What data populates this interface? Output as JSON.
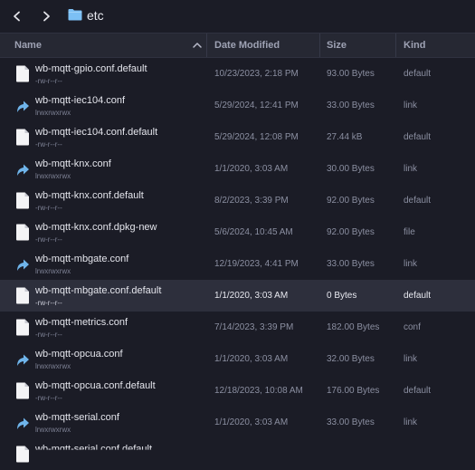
{
  "toolbar": {
    "back_icon": "chevron-left-icon",
    "forward_icon": "chevron-right-icon",
    "folder_icon": "folder-icon",
    "path": "etc"
  },
  "columns": {
    "name": "Name",
    "date": "Date Modified",
    "size": "Size",
    "kind": "Kind"
  },
  "colors": {
    "background": "#1b1c26",
    "header": "#262833",
    "selected_row": "#2d2f3c",
    "link_icon": "#6fb4ea",
    "file_icon": "#f4f4f6"
  },
  "files": [
    {
      "name": "wb-mqtt-gpio.conf.default",
      "perm": "-rw-r--r--",
      "date": "10/23/2023, 2:18 PM",
      "size": "93.00 Bytes",
      "kind": "default",
      "icon": "file-icon"
    },
    {
      "name": "wb-mqtt-iec104.conf",
      "perm": "lrwxrwxrwx",
      "date": "5/29/2024, 12:41 PM",
      "size": "33.00 Bytes",
      "kind": "link",
      "icon": "link-icon"
    },
    {
      "name": "wb-mqtt-iec104.conf.default",
      "perm": "-rw-r--r--",
      "date": "5/29/2024, 12:08 PM",
      "size": "27.44 kB",
      "kind": "default",
      "icon": "file-icon"
    },
    {
      "name": "wb-mqtt-knx.conf",
      "perm": "lrwxrwxrwx",
      "date": "1/1/2020, 3:03 AM",
      "size": "30.00 Bytes",
      "kind": "link",
      "icon": "link-icon"
    },
    {
      "name": "wb-mqtt-knx.conf.default",
      "perm": "-rw-r--r--",
      "date": "8/2/2023, 3:39 PM",
      "size": "92.00 Bytes",
      "kind": "default",
      "icon": "file-icon"
    },
    {
      "name": "wb-mqtt-knx.conf.dpkg-new",
      "perm": "-rw-r--r--",
      "date": "5/6/2024, 10:45 AM",
      "size": "92.00 Bytes",
      "kind": "file",
      "icon": "file-icon"
    },
    {
      "name": "wb-mqtt-mbgate.conf",
      "perm": "lrwxrwxrwx",
      "date": "12/19/2023, 4:41 PM",
      "size": "33.00 Bytes",
      "kind": "link",
      "icon": "link-icon"
    },
    {
      "name": "wb-mqtt-mbgate.conf.default",
      "perm": "-rw-r--r--",
      "date": "1/1/2020, 3:03 AM",
      "size": "0 Bytes",
      "kind": "default",
      "icon": "file-icon",
      "selected": true
    },
    {
      "name": "wb-mqtt-metrics.conf",
      "perm": "-rw-r--r--",
      "date": "7/14/2023, 3:39 PM",
      "size": "182.00 Bytes",
      "kind": "conf",
      "icon": "file-icon"
    },
    {
      "name": "wb-mqtt-opcua.conf",
      "perm": "lrwxrwxrwx",
      "date": "1/1/2020, 3:03 AM",
      "size": "32.00 Bytes",
      "kind": "link",
      "icon": "link-icon"
    },
    {
      "name": "wb-mqtt-opcua.conf.default",
      "perm": "-rw-r--r--",
      "date": "12/18/2023, 10:08 AM",
      "size": "176.00 Bytes",
      "kind": "default",
      "icon": "file-icon"
    },
    {
      "name": "wb-mqtt-serial.conf",
      "perm": "lrwxrwxrwx",
      "date": "1/1/2020, 3:03 AM",
      "size": "33.00 Bytes",
      "kind": "link",
      "icon": "link-icon"
    },
    {
      "name": "wb-mqtt-serial.conf.default",
      "perm": "",
      "date": "",
      "size": "",
      "kind": "",
      "icon": "file-icon",
      "partial": true
    }
  ]
}
